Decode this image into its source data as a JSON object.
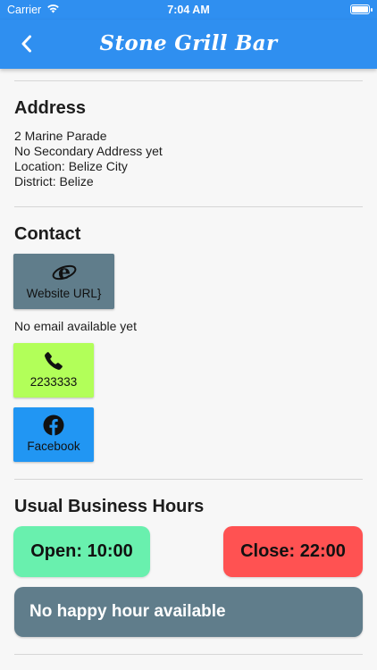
{
  "status_bar": {
    "carrier": "Carrier",
    "time": "7:04 AM"
  },
  "nav": {
    "title": "Stone Grill Bar",
    "back_icon": "chevron-left-icon"
  },
  "address": {
    "title": "Address",
    "line1": "2 Marine Parade",
    "line2": "No Secondary Address  yet",
    "location": "Location: Belize City",
    "district": "District: Belize"
  },
  "contact": {
    "title": "Contact",
    "website_label": "Website URL}",
    "website_icon": "internet-explorer-icon",
    "email_text": "No email available yet",
    "phone_label": "2233333",
    "phone_icon": "phone-icon",
    "facebook_label": "Facebook",
    "facebook_icon": "facebook-icon"
  },
  "hours": {
    "title": "Usual Business Hours",
    "open": "Open: 10:00",
    "close": "Close: 22:00",
    "happy_hour": "No happy hour available"
  },
  "colors": {
    "accent": "#2f8ff0",
    "website_tile": "#607d8b",
    "phone_tile": "#b2ff59",
    "facebook_tile": "#2196f3",
    "open_pill": "#69f0ae",
    "close_pill": "#ff5252",
    "happy_pill": "#607d8b"
  }
}
